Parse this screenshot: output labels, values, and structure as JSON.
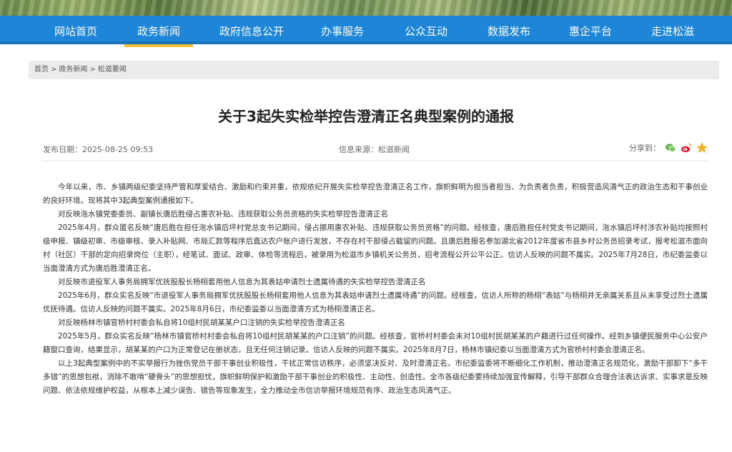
{
  "nav": {
    "items": [
      {
        "label": "网站首页"
      },
      {
        "label": "政务新闻"
      },
      {
        "label": "政府信息公开"
      },
      {
        "label": "办事服务"
      },
      {
        "label": "公众互动"
      },
      {
        "label": "数据发布"
      },
      {
        "label": "惠企平台"
      },
      {
        "label": "走进松滋"
      }
    ],
    "active_index": 1,
    "accent": "#f2c230",
    "background": "#1d86d8"
  },
  "breadcrumb": {
    "items": [
      "首页",
      "政务新闻",
      "松滋要闻"
    ],
    "separator": ">"
  },
  "article": {
    "title": "关于3起失实检举控告澄清正名典型案例的通报",
    "date_label": "发布日期：2025-08-25 09:53",
    "source_label": "信息来源：松滋新闻",
    "share_label": "分享到：",
    "share_icons": [
      "wechat-icon",
      "weibo-icon",
      "favorite-star-icon"
    ],
    "paragraphs": [
      "今年以来，市、乡镇两级纪委坚持严管和厚爱结合、激励和约束并重，依规依纪开展失实检举控告澄清正名工作，旗帜鲜明为担当者担当、为负责者负责，积极营造风清气正的政治生态和干事创业的良好环境。现将其中3起典型案例通报如下。",
      "对反映沲水镇党委委员、副镇长唐后胜侵占惠农补贴、违规获取公务员资格的失实检举控告澄清正名",
      "2025年4月，群众匿名反映“唐后胜在担任沲水镇后坪村党总支书记期间，侵占挪用惠农补贴、违规获取公务员资格”的问题。经核查，唐后胜担任村党支书记期间，沲水镇后坪村涉农补贴均按照村级申报、镇级初审、市级审核、录入补贴网、市局汇款等程序后直达农户账户进行发放，不存在村干部侵占截留的问题。且唐后胜报名参加湖北省2012年度省市县乡村公务员招录考试，报考松滋市面向村（社区）干部的定向招录岗位（主职），经笔试、面试、政审、体检等流程后，被录用为松滋市乡镇机关公务员，招考流程公开公平公正。信访人反映的问题不属实。2025年7月28日，市纪委监委以当面澄清方式为唐后胜澄清正名。",
      "对反映市退役军人事务局拥军优抚股股长杨栩套用他人信息为其表姑申请烈士遗属待遇的失实检举控告澄清正名",
      "2025年6月，群众实名反映“市退役军人事务局拥军优抚股股长杨栩套用他人信息为其表姑申请烈士遗属待遇”的问题。经核查，信访人所称的杨栩“表姑”与杨栩并无亲属关系且从未享受过烈士遗属优抚待遇。信访人反映的问题不属实。2025年8月6日，市纪委监委以当面澄清方式为杨栩澄清正名。",
      "对反映杨林市镇官桥村村委会私自将10组村民胡某某户口注销的失实检举控告澄清正名",
      "2025年5月，群众实名反映“杨林市镇官桥村村委会私自将10组村民胡某某的户口注销”的问题。经核查，官桥村村委会未对10组村民胡某某的户籍进行过任何操作。经到乡镇便民服务中心公安户籍窗口查询，结果显示，胡某某的户口为正常登记在册状态，且无任何注销记录。信访人反映的问题不属实。2025年8月7日，杨林市镇纪委以当面澄清方式为官桥村村委会澄清正名。",
      "以上3起典型案例中的不实举报行为挫伤党员干部干事创业积极性，干扰正常信访秩序，必须坚决反对、及时澄清正名。市纪委监委将不断细化工作机制，推动澄清正名规范化，激励干部卸下“多干多错”的思想包袱，消除不敢啃“硬骨头”的思想担忧，旗帜鲜明保护和激励干部干事创业的积极性、主动性、创造性。全市各级纪委要持续加强宣传解释，引导干部群众合理合法表达诉求、实事求是反映问题、依法依规维护权益，从根本上减少误告、错告等现象发生，全力推动全市信访举报环境规范有序、政治生态风清气正。"
    ]
  }
}
